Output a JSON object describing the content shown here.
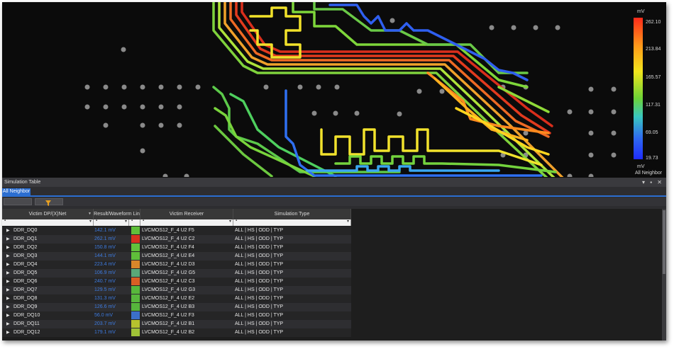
{
  "legend": {
    "unit_top": "mV",
    "labels": [
      "262.10",
      "213.84",
      "165.57",
      "117.31",
      "69.05",
      "19.73"
    ],
    "unit_bottom": "mV",
    "footer": "All Neighbor",
    "gradient_colors": [
      "#ff2a1a",
      "#ff9a1a",
      "#f1e51c",
      "#6dd337",
      "#39c7c0",
      "#2f6af0",
      "#1f2cff"
    ]
  },
  "panel": {
    "title": "Simulation Table",
    "window_controls": [
      "▾",
      "▪",
      "✕"
    ],
    "tab": "All Neighbor",
    "accent": "#2b6ed1"
  },
  "table": {
    "headers": {
      "victim": "Victim DP/(X)Net",
      "result": "Result/Waveform Lin",
      "receiver": "Victim Receiver",
      "simtype": "Simulation Type"
    },
    "rows": [
      {
        "net": "DDR_DQ0",
        "value": "142.1 mV",
        "color": "#5fbf3a",
        "receiver": "LVCMOS12_F_4 U2 F5",
        "sim": "ALL | HS | ODD | TYP"
      },
      {
        "net": "DDR_DQ1",
        "value": "262.1 mV",
        "color": "#d6321f",
        "receiver": "LVCMOS12_F_4 U2 C2",
        "sim": "ALL | HS | ODD | TYP"
      },
      {
        "net": "DDR_DQ2",
        "value": "150.8 mV",
        "color": "#62c23c",
        "receiver": "LVCMOS12_F_4 U2 F4",
        "sim": "ALL | HS | ODD | TYP"
      },
      {
        "net": "DDR_DQ3",
        "value": "144.1 mV",
        "color": "#5fbf3a",
        "receiver": "LVCMOS12_F_4 U2 E4",
        "sim": "ALL | HS | ODD | TYP"
      },
      {
        "net": "DDR_DQ4",
        "value": "223.4 mV",
        "color": "#d9862a",
        "receiver": "LVCMOS12_F_4 U2 D3",
        "sim": "ALL | HS | ODD | TYP"
      },
      {
        "net": "DDR_DQ5",
        "value": "106.9 mV",
        "color": "#5aa878",
        "receiver": "LVCMOS12_F_4 U2 G5",
        "sim": "ALL | HS | ODD | TYP"
      },
      {
        "net": "DDR_DQ6",
        "value": "240.7 mV",
        "color": "#d95f24",
        "receiver": "LVCMOS12_F_4 U2 C3",
        "sim": "ALL | HS | ODD | TYP"
      },
      {
        "net": "DDR_DQ7",
        "value": "129.5 mV",
        "color": "#58b83c",
        "receiver": "LVCMOS12_F_4 U2 G3",
        "sim": "ALL | HS | ODD | TYP"
      },
      {
        "net": "DDR_DQ8",
        "value": "131.3 mV",
        "color": "#58b83c",
        "receiver": "LVCMOS12_F_4 U2 E2",
        "sim": "ALL | HS | ODD | TYP"
      },
      {
        "net": "DDR_DQ9",
        "value": "126.6 mV",
        "color": "#56b63c",
        "receiver": "LVCMOS12_F_4 U2 B3",
        "sim": "ALL | HS | ODD | TYP"
      },
      {
        "net": "DDR_DQ10",
        "value": "56.0 mV",
        "color": "#3b6fc9",
        "receiver": "LVCMOS12_F_4 U2 F3",
        "sim": "ALL | HS | ODD | TYP"
      },
      {
        "net": "DDR_DQ11",
        "value": "203.7 mV",
        "color": "#b6c22e",
        "receiver": "LVCMOS12_F_4 U2 B1",
        "sim": "ALL | HS | ODD | TYP"
      },
      {
        "net": "DDR_DQ12",
        "value": "179.1 mV",
        "color": "#9fc237",
        "receiver": "LVCMOS12_F_4 U2 B2",
        "sim": "ALL | HS | ODD | TYP"
      }
    ]
  }
}
